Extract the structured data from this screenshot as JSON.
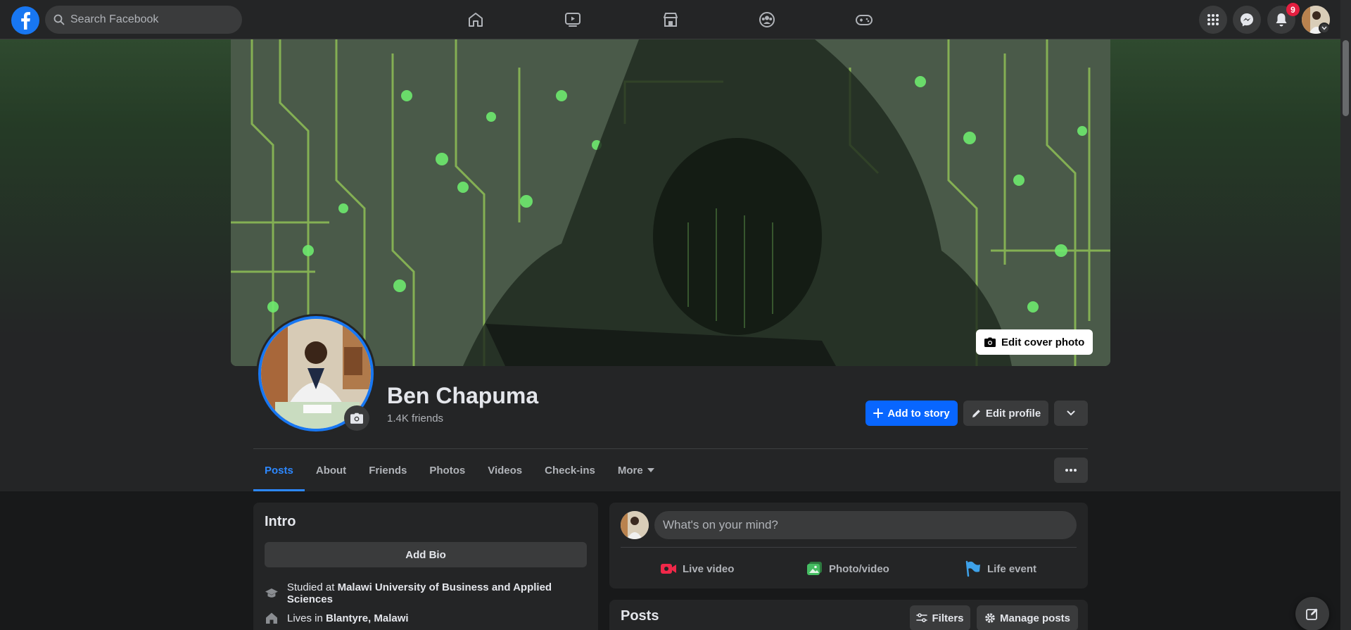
{
  "topbar": {
    "search_placeholder": "Search Facebook",
    "nav_icons": [
      "home-icon",
      "watch-icon",
      "marketplace-icon",
      "groups-icon",
      "gaming-icon"
    ],
    "notifications_count": "9"
  },
  "profile": {
    "name": "Ben Chapuma",
    "friends": "1.4K friends",
    "edit_cover_label": "Edit cover photo",
    "add_story_label": "Add to story",
    "edit_profile_label": "Edit profile"
  },
  "tabs": [
    "Posts",
    "About",
    "Friends",
    "Photos",
    "Videos",
    "Check-ins",
    "More"
  ],
  "active_tab": "Posts",
  "intro": {
    "title": "Intro",
    "add_bio": "Add Bio",
    "studied_prefix": "Studied at ",
    "studied_at": "Malawi University of Business and Applied Sciences",
    "lives_prefix": "Lives in ",
    "lives_in": "Blantyre, Malawi"
  },
  "composer": {
    "placeholder": "What's on your mind?",
    "actions": [
      "Live video",
      "Photo/video",
      "Life event"
    ]
  },
  "posts": {
    "title": "Posts",
    "filters_label": "Filters",
    "manage_label": "Manage posts"
  },
  "colors": {
    "accent": "#0866ff",
    "active_tab": "#2d88ff",
    "badge": "#e41e3f",
    "live": "#f02849",
    "photo": "#45bd62",
    "life": "#3ea2ea"
  }
}
